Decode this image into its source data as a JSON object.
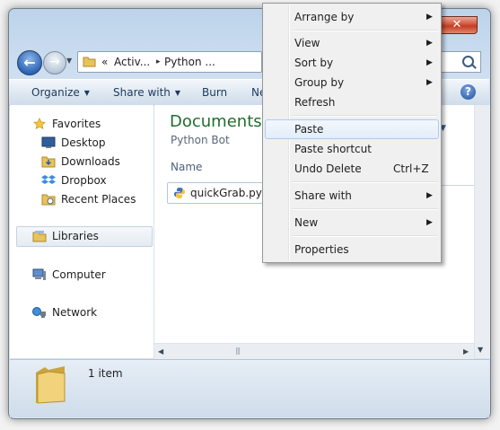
{
  "window": {
    "close_glyph": "✕"
  },
  "address_bar": {
    "chevron": "«",
    "crumbs": [
      "Activ...",
      "Python ..."
    ],
    "separator": "▸"
  },
  "toolbar": {
    "organize": "Organize",
    "share_with": "Share with",
    "burn": "Burn",
    "new_folder_partial": "Ne",
    "help_glyph": "?"
  },
  "nav": {
    "favorites": "Favorites",
    "desktop": "Desktop",
    "downloads": "Downloads",
    "dropbox": "Dropbox",
    "recent_places": "Recent Places",
    "libraries": "Libraries",
    "computer": "Computer",
    "network": "Network"
  },
  "content": {
    "library_title": "Documents l",
    "library_subtitle": "Python Bot",
    "column_name": "Name",
    "files": [
      {
        "name": "quickGrab.py"
      }
    ]
  },
  "details": {
    "item_count": "1 item"
  },
  "context_menu": {
    "items": [
      {
        "label": "Arrange by",
        "submenu": true
      },
      {
        "label": "View",
        "submenu": true
      },
      {
        "label": "Sort by",
        "submenu": true
      },
      {
        "label": "Group by",
        "submenu": true
      },
      {
        "label": "Refresh"
      },
      {
        "label": "Paste",
        "highlighted": true
      },
      {
        "label": "Paste shortcut"
      },
      {
        "label": "Undo Delete",
        "shortcut": "Ctrl+Z"
      },
      {
        "label": "Share with",
        "submenu": true
      },
      {
        "label": "New",
        "submenu": true
      },
      {
        "label": "Properties"
      }
    ],
    "submenu_glyph": "▶"
  },
  "colors": {
    "accent_title": "#1f6e2e",
    "toolbar_text": "#1e395b",
    "close_red": "#c33e24"
  }
}
